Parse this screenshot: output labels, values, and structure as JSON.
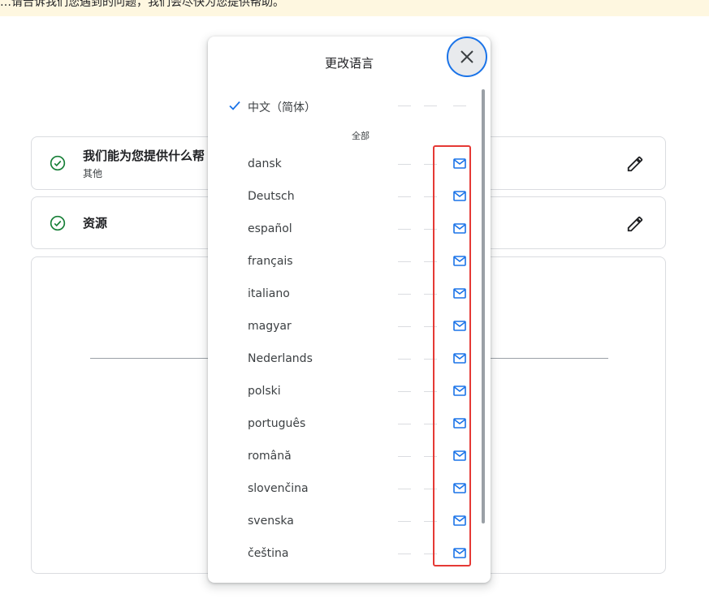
{
  "banner": {
    "text": "…请告诉我们您遇到的问题，我们会尽快为您提供帮助。"
  },
  "cards": [
    {
      "title": "我们能为您提供什么帮",
      "subtitle": "其他"
    },
    {
      "title": "资源",
      "subtitle": ""
    }
  ],
  "dialog": {
    "title": "更改语言",
    "selected_language": "中文（简体）",
    "section_label": "全部",
    "languages": [
      {
        "label": "dansk"
      },
      {
        "label": "Deutsch"
      },
      {
        "label": "español"
      },
      {
        "label": "français"
      },
      {
        "label": "italiano"
      },
      {
        "label": "magyar"
      },
      {
        "label": "Nederlands"
      },
      {
        "label": "polski"
      },
      {
        "label": "português"
      },
      {
        "label": "română"
      },
      {
        "label": "slovenčina"
      },
      {
        "label": "svenska"
      },
      {
        "label": "čeština"
      }
    ]
  },
  "icons": {
    "check": "check-circle-icon",
    "edit": "pencil-icon",
    "close": "close-icon",
    "selected": "checkmark-icon",
    "mail": "mail-icon"
  },
  "colors": {
    "accent": "#1a73e8",
    "success": "#188038",
    "highlight": "#e53935",
    "banner": "#fef7e0"
  }
}
